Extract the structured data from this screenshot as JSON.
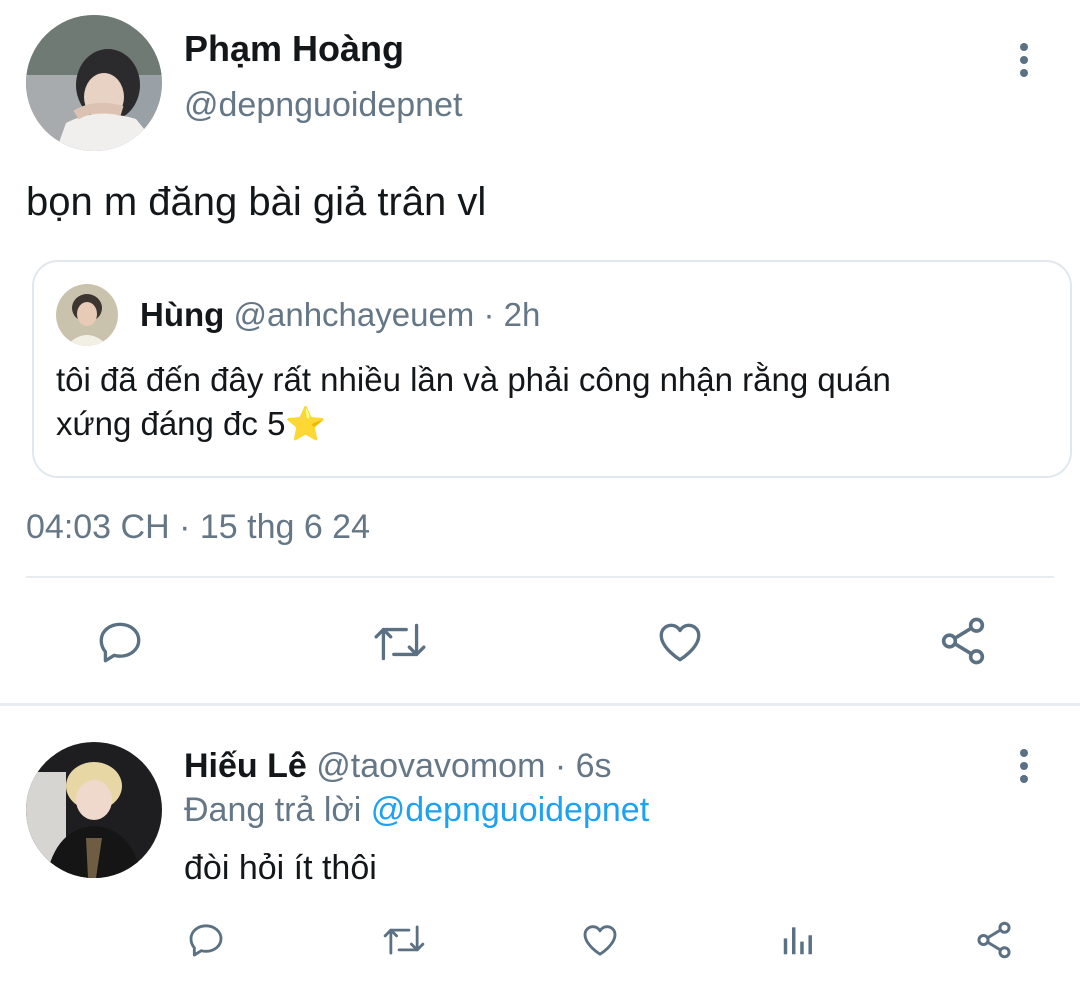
{
  "main_tweet": {
    "author_name": "Phạm Hoàng",
    "author_handle": "@depnguoidepnet",
    "text": "bọn m đăng bài giả trân vl",
    "timestamp": "04:03 CH · 15 thg 6 24",
    "quoted_tweet": {
      "author_name": "Hùng",
      "author_handle": "@anhchayeuem",
      "time": "· 2h",
      "text_line1": "tôi đã đến đây rất nhiều lần và phải công nhận rằng quán",
      "text_line2": "xứng đáng đc 5",
      "emoji": "⭐"
    }
  },
  "reply": {
    "author_name": "Hiếu Lê",
    "author_handle": "@taovavomom",
    "time": "· 6s",
    "replying_prefix": "Đang trả lời",
    "replying_handle": "@depnguoidepnet",
    "text": "đòi hỏi ít thôi"
  },
  "colors": {
    "accent": "#1da1f2",
    "muted": "#657786",
    "icon": "#5b7083",
    "divider": "#e6ecf0"
  },
  "icons": [
    "more-vertical-icon",
    "reply-icon",
    "retweet-icon",
    "like-icon",
    "share-icon",
    "analytics-icon",
    "star-emoji"
  ]
}
